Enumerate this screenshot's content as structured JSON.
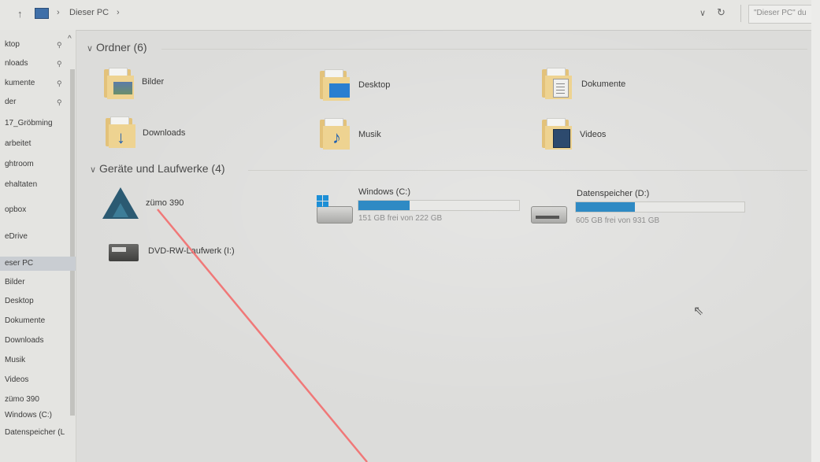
{
  "address_bar": {
    "crumb": "Dieser PC",
    "search_placeholder": "\"Dieser PC\" du"
  },
  "nav": {
    "items": [
      {
        "label": "ktop",
        "pinned": true
      },
      {
        "label": "nloads",
        "pinned": true
      },
      {
        "label": "kumente",
        "pinned": true
      },
      {
        "label": "der",
        "pinned": true
      },
      {
        "label": "17_Gröbming",
        "pinned": false
      },
      {
        "label": "arbeitet",
        "pinned": false
      },
      {
        "label": "ghtroom",
        "pinned": false
      },
      {
        "label": "ehaltaten",
        "pinned": false
      },
      {
        "label": "opbox",
        "pinned": false
      },
      {
        "label": "eDrive",
        "pinned": false
      },
      {
        "label": "eser PC",
        "pinned": false,
        "selected": true
      },
      {
        "label": "Bilder",
        "pinned": false
      },
      {
        "label": "Desktop",
        "pinned": false
      },
      {
        "label": "Dokumente",
        "pinned": false
      },
      {
        "label": "Downloads",
        "pinned": false
      },
      {
        "label": "Musik",
        "pinned": false
      },
      {
        "label": "Videos",
        "pinned": false
      },
      {
        "label": "zümo 390",
        "pinned": false
      },
      {
        "label": "Windows (C:)",
        "pinned": false
      },
      {
        "label": "Datenspeicher (L",
        "pinned": false
      }
    ]
  },
  "folders_section": {
    "header": "Ordner (6)",
    "items": [
      {
        "label": "Bilder",
        "icon": "pictures-folder-icon"
      },
      {
        "label": "Desktop",
        "icon": "desktop-folder-icon"
      },
      {
        "label": "Dokumente",
        "icon": "documents-folder-icon"
      },
      {
        "label": "Downloads",
        "icon": "downloads-folder-icon"
      },
      {
        "label": "Musik",
        "icon": "music-folder-icon"
      },
      {
        "label": "Videos",
        "icon": "videos-folder-icon"
      }
    ]
  },
  "drives_section": {
    "header": "Geräte und Laufwerke (4)",
    "items": [
      {
        "label": "zümo 390",
        "icon": "garmin-device-icon"
      },
      {
        "label": "Windows (C:)",
        "icon": "windows-drive-icon",
        "free_text": "151 GB frei von 222 GB",
        "used_fraction": 0.32
      },
      {
        "label": "Datenspeicher (D:)",
        "icon": "hard-drive-icon",
        "free_text": "605 GB frei von 931 GB",
        "used_fraction": 0.35
      },
      {
        "label": "DVD-RW-Laufwerk (I:)",
        "icon": "dvd-drive-icon"
      }
    ]
  },
  "colors": {
    "accent": "#2f8ac4",
    "annotation_line": "#f07878"
  }
}
